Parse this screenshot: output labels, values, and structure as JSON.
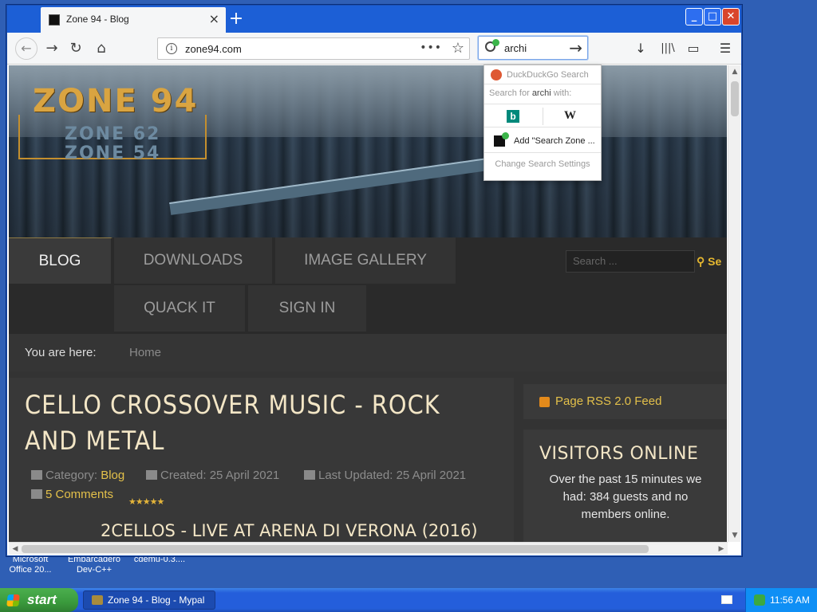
{
  "desktop": {
    "icons": [
      {
        "label": "Microsoft Office 20..."
      },
      {
        "label": "Embarcadero Dev-C++"
      },
      {
        "label": "cdemu-0.3...."
      }
    ]
  },
  "browser": {
    "tab": {
      "title": "Zone 94 - Blog",
      "close": "×"
    },
    "new_tab": "+",
    "window_buttons": {
      "minimize": "_",
      "maximize": "□",
      "close": "✕"
    },
    "nav": {
      "back": "←",
      "forward": "→",
      "reload": "↻",
      "home": "⌂"
    },
    "url": "zone94.com",
    "url_actions": {
      "more": "•••",
      "bookmark": "☆"
    },
    "search_value": "archi",
    "search_go": "→",
    "toolbar": {
      "download": "↓",
      "library": "|||\\",
      "sidebar": "▭",
      "menu": "☰"
    }
  },
  "search_dropdown": {
    "engine": "DuckDuckGo Search",
    "search_for_prefix": "Search for",
    "search_for_term": "archi",
    "search_for_suffix": "with:",
    "bing_letter": "b",
    "wiki_letter": "W",
    "add_label": "Add \"Search Zone ...",
    "settings": "Change Search Settings"
  },
  "site": {
    "logo": {
      "main": "ZONE 94",
      "sub1": "ZONE 62",
      "sub2": "ZONE 54"
    },
    "menu": [
      {
        "label": "BLOG",
        "active": true
      },
      {
        "label": "DOWNLOADS"
      },
      {
        "label": "IMAGE GALLERY"
      },
      {
        "label": "QUACK IT"
      },
      {
        "label": "SIGN IN"
      }
    ],
    "search_placeholder": "Search ...",
    "search_button": "Se",
    "breadcrumb": {
      "label": "You are here:",
      "home": "Home"
    },
    "article": {
      "title": "CELLO CROSSOVER MUSIC - ROCK AND METAL",
      "category_label": "Category:",
      "category": "Blog",
      "created": "Created: 25 April 2021",
      "updated": "Last Updated: 25 April 2021",
      "comments": "5 Comments",
      "rating_stars": "★★★★★",
      "subheading": "2CELLOS - LIVE AT ARENA DI VERONA (2016)"
    },
    "sidebar": {
      "rss": "Page RSS 2.0 Feed",
      "visitors_title": "VISITORS ONLINE",
      "visitors_text": "Over the past 15 minutes we had: 384 guests and no members online."
    }
  },
  "taskbar": {
    "start": "start",
    "task": "Zone 94 - Blog - Mypal",
    "time": "11:56 AM"
  }
}
